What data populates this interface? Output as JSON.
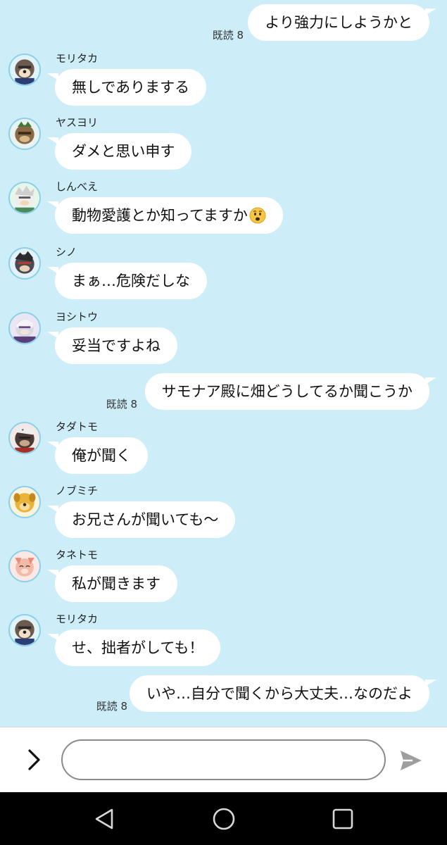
{
  "messages": [
    {
      "type": "out",
      "text": "より強力にしようかと",
      "read": "既読 8"
    },
    {
      "type": "in",
      "sender": "モリタカ",
      "avatar": "moritaka-avatar",
      "text": "無しでありまする"
    },
    {
      "type": "in",
      "sender": "ヤスヨリ",
      "avatar": "yasuyori-avatar",
      "text": "ダメと思い申す"
    },
    {
      "type": "in",
      "sender": "しんべえ",
      "avatar": "shinbee-avatar",
      "text": "動物愛護とか知ってますか",
      "emoji": "anguished-face-emoji"
    },
    {
      "type": "in",
      "sender": "シノ",
      "avatar": "shino-avatar",
      "text": "まぁ…危険だしな"
    },
    {
      "type": "in",
      "sender": "ヨシトウ",
      "avatar": "yoshitou-avatar",
      "text": "妥当ですよね"
    },
    {
      "type": "out",
      "text": "サモナア殿に畑どうしてるか聞こうか",
      "read": "既読 8"
    },
    {
      "type": "in",
      "sender": "タダトモ",
      "avatar": "tadatomo-avatar",
      "text": "俺が聞く"
    },
    {
      "type": "in",
      "sender": "ノブミチ",
      "avatar": "nobumichi-avatar",
      "text": "お兄さんが聞いても〜"
    },
    {
      "type": "in",
      "sender": "タネトモ",
      "avatar": "tanetomo-avatar",
      "text": "私が聞きます"
    },
    {
      "type": "in",
      "sender": "モリタカ",
      "avatar": "moritaka-avatar",
      "text": "せ、拙者がしても！"
    },
    {
      "type": "out",
      "text": "いや…自分で聞くから大丈夫…なのだよ",
      "read": "既読 8"
    }
  ],
  "input": {
    "value": "",
    "placeholder": ""
  },
  "icons": {
    "expand": "chevron-right-icon",
    "send": "send-icon",
    "nav_back": "back-triangle-icon",
    "nav_home": "home-circle-icon",
    "nav_recents": "recents-square-icon"
  },
  "colors": {
    "chat_background": "#cdeef9",
    "bubble": "#ffffff",
    "input_bar": "#ffffff",
    "nav_bar": "#000000",
    "send_icon": "#9e9e9e",
    "avatar_ring": "#8ad0ea"
  }
}
